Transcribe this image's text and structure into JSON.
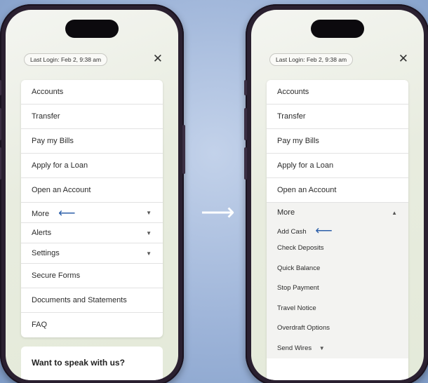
{
  "last_login": "Last Login: Feb 2, 9:38 am",
  "close_icon": "close-icon",
  "transition_icon": "right-arrow-icon",
  "left_screen": {
    "menu_items": [
      {
        "label": "Accounts"
      },
      {
        "label": "Transfer"
      },
      {
        "label": "Pay my Bills"
      },
      {
        "label": "Apply for a Loan"
      },
      {
        "label": "Open an Account"
      },
      {
        "label": "More"
      },
      {
        "label": "Alerts"
      },
      {
        "label": "Settings"
      },
      {
        "label": "Secure Forms"
      },
      {
        "label": "Documents and Statements"
      },
      {
        "label": "FAQ"
      }
    ],
    "speak_heading": "Want to speak with us?"
  },
  "right_screen": {
    "menu_items": [
      {
        "label": "Accounts"
      },
      {
        "label": "Transfer"
      },
      {
        "label": "Pay my Bills"
      },
      {
        "label": "Apply for a Loan"
      },
      {
        "label": "Open an Account"
      },
      {
        "label": "More"
      }
    ],
    "more_submenu": [
      {
        "label": "Add Cash"
      },
      {
        "label": "Check Deposits"
      },
      {
        "label": "Quick Balance"
      },
      {
        "label": "Stop Payment"
      },
      {
        "label": "Travel Notice"
      },
      {
        "label": "Overdraft Options"
      },
      {
        "label": "Send Wires"
      }
    ]
  },
  "colors": {
    "accent_arrow": "#2c5fa9",
    "background": "#9cb3d8"
  }
}
